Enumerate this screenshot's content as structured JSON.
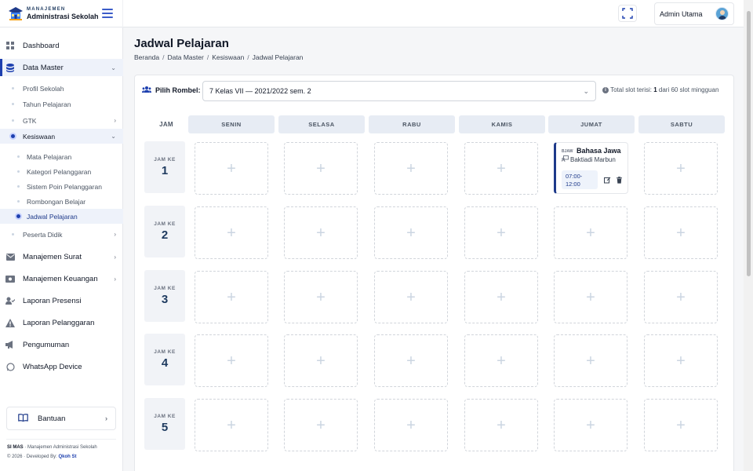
{
  "brand": {
    "small": "MANAJEMEN",
    "big": "Administrasi Sekolah"
  },
  "header": {
    "user_name": "Admin Utama"
  },
  "sidebar": {
    "dashboard": "Dashboard",
    "data_master": "Data Master",
    "profil_sekolah": "Profil Sekolah",
    "tahun_pelajaran": "Tahun Pelajaran",
    "gtk": "GTK",
    "kesiswaan": "Kesiswaan",
    "mata_pelajaran": "Mata Pelajaran",
    "kategori_pelanggaran": "Kategori Pelanggaran",
    "sistem_poin": "Sistem Poin Pelanggaran",
    "rombongan_belajar": "Rombongan Belajar",
    "jadwal_pelajaran": "Jadwal Pelajaran",
    "peserta_didik": "Peserta Didik",
    "manajemen_surat": "Manajemen Surat",
    "manajemen_keuangan": "Manajemen Keuangan",
    "laporan_presensi": "Laporan Presensi",
    "laporan_pelanggaran": "Laporan Pelanggaran",
    "pengumuman": "Pengumuman",
    "whatsapp_device": "WhatsApp Device",
    "bantuan": "Bantuan",
    "footer_app": "SI MAS",
    "footer_app_desc": " · Manajemen Administrasi Sekolah",
    "footer_copy": "© 2026 · Developed By: ",
    "footer_dev": "Qkoh St"
  },
  "main": {
    "title": "Jadwal Pelajaran",
    "breadcrumb": [
      "Beranda",
      "Data Master",
      "Kesiswaan",
      "Jadwal Pelajaran"
    ],
    "rombel_label": "Pilih Rombel:",
    "rombel_value": "7 Kelas VII — 2021/2022 sem. 2",
    "slot_info_prefix": "Total slot terisi: ",
    "slot_filled": "1",
    "slot_info_suffix": " dari 60 slot mingguan"
  },
  "schedule": {
    "jam_header": "JAM",
    "days": [
      "SENIN",
      "SELASA",
      "RABU",
      "KAMIS",
      "JUMAT",
      "SABTU"
    ],
    "jam_label": "JAM KE",
    "jam_numbers": [
      "1",
      "2",
      "3",
      "4",
      "5"
    ],
    "entry": {
      "code": "BJAW",
      "subject": "Bahasa Jawa",
      "teacher": "Baktiadi Marbun",
      "time_start": "07:00-",
      "time_end": "12:00"
    }
  },
  "colors": {
    "accent": "#1e40af",
    "active_bg": "#eef2fa"
  }
}
